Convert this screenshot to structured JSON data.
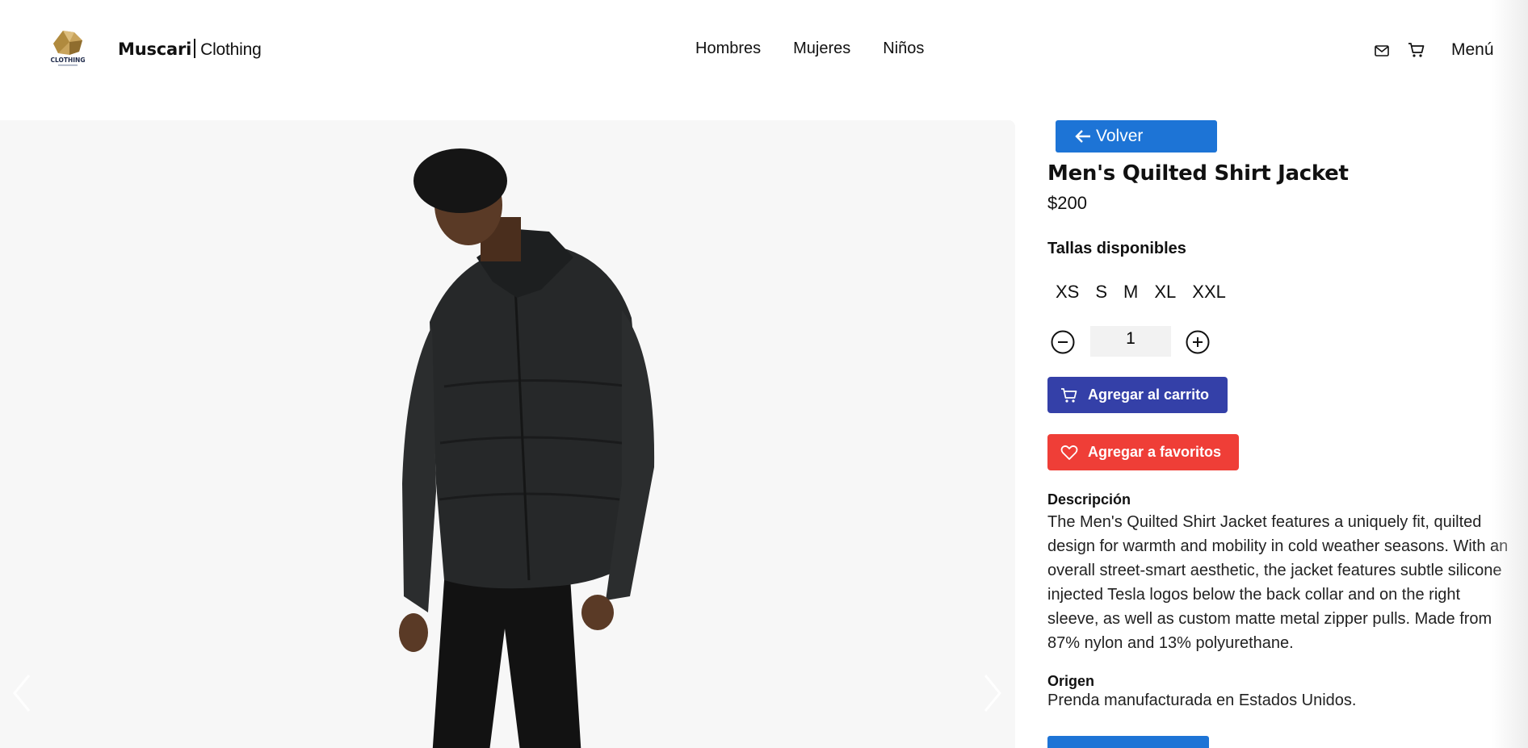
{
  "header": {
    "logo_text": "CLOTHING",
    "brand_primary": "Muscari",
    "brand_secondary": "Clothing",
    "nav": [
      {
        "label": "Hombres"
      },
      {
        "label": "Mujeres"
      },
      {
        "label": "Niños"
      }
    ],
    "icons": [
      "mail-icon",
      "cart-icon"
    ],
    "menu_label": "Menú"
  },
  "product": {
    "back_label": "Volver",
    "title": "Men's Quilted Shirt Jacket",
    "price": "$200",
    "sizes_label": "Tallas disponibles",
    "sizes": [
      "XS",
      "S",
      "M",
      "XL",
      "XXL"
    ],
    "quantity": "1",
    "add_to_cart_label": "Agregar al carrito",
    "add_to_favorites_label": "Agregar a favoritos",
    "description_label": "Descripción",
    "description": "The Men's Quilted Shirt Jacket features a uniquely fit, quilted design for warmth and mobility in cold weather seasons. With an overall street-smart aesthetic, the jacket features subtle silicone injected Tesla logos below the back collar and on the right sleeve, as well as custom matte metal zipper pulls. Made from 87% nylon and 13% polyurethane.",
    "origin_label": "Origen",
    "origin": "Prenda manufacturada en Estados Unidos."
  },
  "colors": {
    "back_button": "#1d74d6",
    "cart_button": "#3440a8",
    "favorites_button": "#ef3e37",
    "gallery_bg": "#f7f7f7"
  }
}
